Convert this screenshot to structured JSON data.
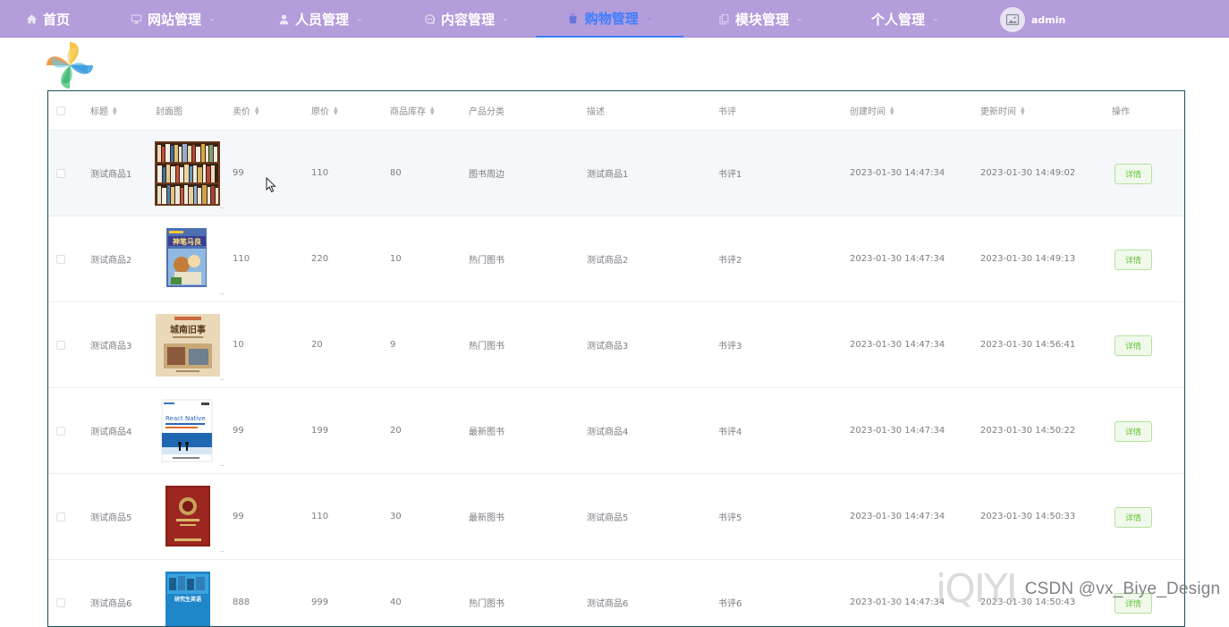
{
  "nav": {
    "items": [
      {
        "label": "首页",
        "icon": "home-icon",
        "has_caret": false
      },
      {
        "label": "网站管理",
        "icon": "monitor-icon",
        "has_caret": true
      },
      {
        "label": "人员管理",
        "icon": "user-icon",
        "has_caret": true
      },
      {
        "label": "内容管理",
        "icon": "chat-icon",
        "has_caret": true
      },
      {
        "label": "购物管理",
        "icon": "bag-icon",
        "has_caret": true,
        "active": true
      },
      {
        "label": "模块管理",
        "icon": "copy-icon",
        "has_caret": true
      },
      {
        "label": "个人管理",
        "icon": "",
        "has_caret": true
      }
    ],
    "user": {
      "name": "admin",
      "icon": "image-avatar-icon"
    },
    "colors": {
      "bar": "#b39ddb",
      "active": "#3d7eff"
    }
  },
  "table": {
    "columns": [
      {
        "key": "title",
        "label": "标题",
        "sortable": true
      },
      {
        "key": "cover",
        "label": "封面图",
        "sortable": false
      },
      {
        "key": "price",
        "label": "卖价",
        "sortable": true
      },
      {
        "key": "original_price",
        "label": "原价",
        "sortable": true
      },
      {
        "key": "stock",
        "label": "商品库存",
        "sortable": true
      },
      {
        "key": "category",
        "label": "产品分类",
        "sortable": false
      },
      {
        "key": "desc",
        "label": "描述",
        "sortable": false
      },
      {
        "key": "review",
        "label": "书评",
        "sortable": false
      },
      {
        "key": "created",
        "label": "创建时间",
        "sortable": true
      },
      {
        "key": "updated",
        "label": "更新时间",
        "sortable": true
      },
      {
        "key": "action",
        "label": "操作",
        "sortable": false
      }
    ],
    "rows": [
      {
        "title": "测试商品1",
        "price": "99",
        "original_price": "110",
        "stock": "80",
        "category": "图书周边",
        "desc": "测试商品1",
        "review": "书评1",
        "created": "2023-01-30 14:47:34",
        "updated": "2023-01-30 14:49:02",
        "action": "详情",
        "cover_ellipsis": "..",
        "cover_icon": "bookshelf-image"
      },
      {
        "title": "测试商品2",
        "price": "110",
        "original_price": "220",
        "stock": "10",
        "category": "热门图书",
        "desc": "测试商品2",
        "review": "书评2",
        "created": "2023-01-30 14:47:34",
        "updated": "2023-01-30 14:49:13",
        "action": "详情",
        "cover_ellipsis": "..",
        "cover_icon": "book-cover-image",
        "cover_title": "神笔马良"
      },
      {
        "title": "测试商品3",
        "price": "10",
        "original_price": "20",
        "stock": "9",
        "category": "热门图书",
        "desc": "测试商品3",
        "review": "书评3",
        "created": "2023-01-30 14:47:34",
        "updated": "2023-01-30 14:56:41",
        "action": "详情",
        "cover_ellipsis": "..",
        "cover_icon": "book-cover-image",
        "cover_title": "城南旧事"
      },
      {
        "title": "测试商品4",
        "price": "99",
        "original_price": "199",
        "stock": "20",
        "category": "最新图书",
        "desc": "测试商品4",
        "review": "书评4",
        "created": "2023-01-30 14:47:34",
        "updated": "2023-01-30 14:50:22",
        "action": "详情",
        "cover_ellipsis": "..",
        "cover_icon": "book-cover-image",
        "cover_title": "React Native"
      },
      {
        "title": "测试商品5",
        "price": "99",
        "original_price": "110",
        "stock": "30",
        "category": "最新图书",
        "desc": "测试商品5",
        "review": "书评5",
        "created": "2023-01-30 14:47:34",
        "updated": "2023-01-30 14:50:33",
        "action": "详情",
        "cover_ellipsis": "..",
        "cover_icon": "book-cover-image"
      },
      {
        "title": "测试商品6",
        "price": "888",
        "original_price": "999",
        "stock": "40",
        "category": "热门图书",
        "desc": "测试商品6",
        "review": "书评6",
        "created": "2023-01-30 14:47:34",
        "updated": "2023-01-30 14:50:43",
        "action": "详情",
        "cover_ellipsis": "",
        "cover_icon": "book-cover-image",
        "cover_title": "研究生英语"
      }
    ]
  },
  "watermark": {
    "text": "CSDN @vx_Biye_Design",
    "logo_icon": "iqiyi-logo"
  }
}
